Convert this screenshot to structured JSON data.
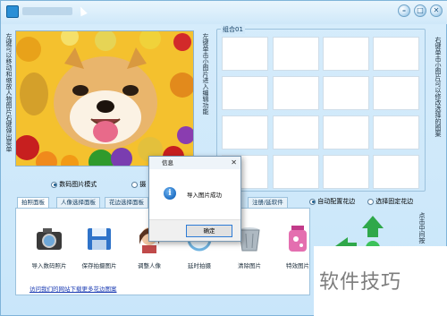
{
  "window": {
    "title": "",
    "controls": [
      {
        "name": "minimize-button",
        "icon": "minimize-icon",
        "glyph": "–"
      },
      {
        "name": "maximize-button",
        "icon": "maximize-icon",
        "glyph": "□"
      },
      {
        "name": "close-button",
        "icon": "close-icon",
        "glyph": "✕"
      }
    ]
  },
  "left_hint": "左键可以移动和缩放人物图片右键弹出菜单",
  "mid_hint": "左键单击小图片进入编辑功能",
  "right_hint": "右键单击小图片可以修改选择的图案",
  "group": {
    "title": "组合01"
  },
  "mode": {
    "option1": "数码图片模式",
    "option2": "摄"
  },
  "tabs": [
    "拍照面板",
    "人像选择面板",
    "花边选择面板",
    "注册/延软件"
  ],
  "frame_options": {
    "auto": "自动配置花边",
    "fixed": "选择固定花边"
  },
  "tools": [
    {
      "label": "导入数码照片",
      "icon": "camera-import-icon"
    },
    {
      "label": "保存拍摄图片",
      "icon": "floppy-save-icon"
    },
    {
      "label": "调整人像",
      "icon": "portrait-adjust-icon"
    },
    {
      "label": "延时拍摄",
      "icon": "timer-clock-icon"
    },
    {
      "label": "清除图片",
      "icon": "trash-bin-icon"
    },
    {
      "label": "特效图片",
      "icon": "effects-jar-icon"
    }
  ],
  "link": "访问我们的网站下载更多花边图案",
  "side_hint": "点击中间按",
  "dialog": {
    "title": "信息",
    "message": "导入图片成功",
    "ok": "确定",
    "close_glyph": "✕",
    "info_glyph": "i"
  },
  "watermark": "软件技巧",
  "colors": {
    "window_bg": "#c9e6fa",
    "accent": "#2d7bd6",
    "link": "#1a3bb3",
    "arrow_green": "#2fa84a"
  }
}
